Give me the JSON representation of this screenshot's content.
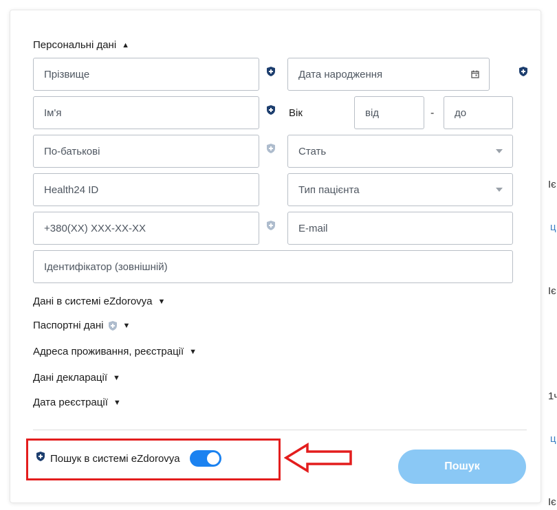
{
  "sections": {
    "personal": "Персональні дані",
    "ezdorovya": "Дані в системі eZdorovya",
    "passport": "Паспортні дані",
    "address": "Адреса проживання, реєстрації",
    "declaration": "Дані декларації",
    "registration": "Дата реєстрації"
  },
  "fields": {
    "surname": "Прізвище",
    "birthdate": "Дата народження",
    "name": "Ім'я",
    "age_label": "Вік",
    "age_from": "від",
    "age_dash": "-",
    "age_to": "до",
    "patronymic": "По-батькові",
    "gender": "Стать",
    "health24": "Health24 ID",
    "patient_type": "Тип пацієнта",
    "phone": "+380(XX) XXX-XX-XX",
    "email": "E-mail",
    "external_id": "Ідентифікатор (зовнішній)"
  },
  "footer": {
    "toggle_label": "Пошук в системі eZdorovya",
    "toggle_on": true,
    "search_button": "Пошук"
  },
  "background_fragments": [
    "Іє",
    "ц",
    "Іє",
    "1ч",
    "ц",
    "Іє"
  ],
  "colors": {
    "shield": "#1d3e6e",
    "shield_light": "#aebccd",
    "toggle": "#1b82f0",
    "button": "#8ac8f5",
    "highlight": "#e31d1d"
  }
}
